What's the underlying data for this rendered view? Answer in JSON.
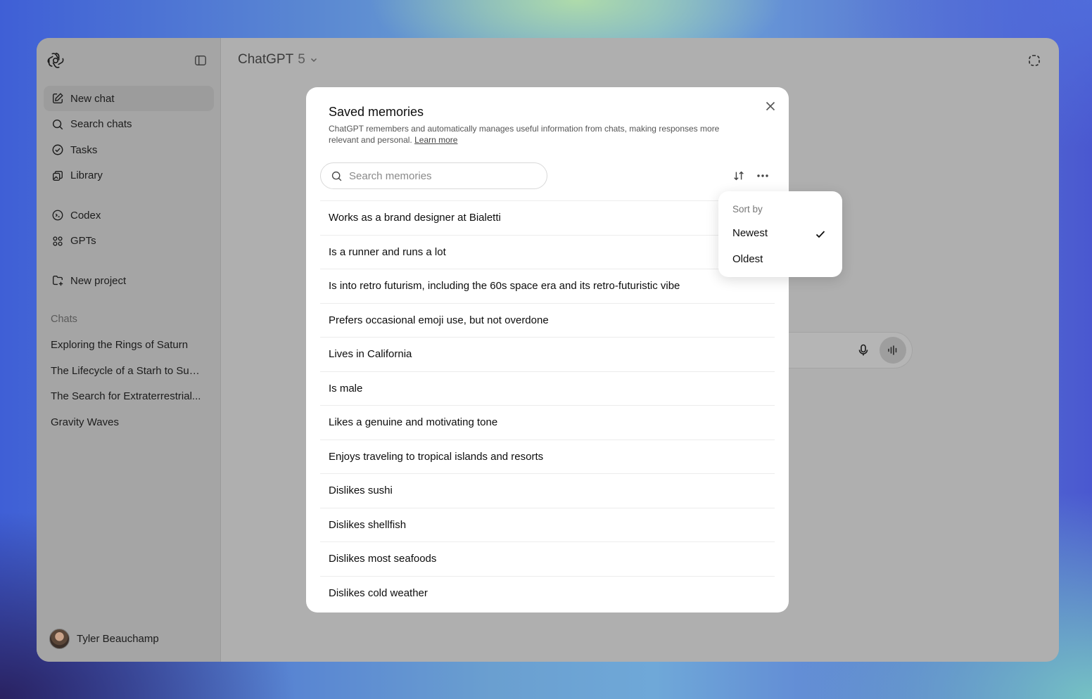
{
  "app": {
    "model_name": "ChatGPT",
    "model_version": "5"
  },
  "sidebar": {
    "nav": [
      {
        "label": "New chat",
        "icon": "edit-icon"
      },
      {
        "label": "Search chats",
        "icon": "search-icon"
      },
      {
        "label": "Tasks",
        "icon": "check-circle-icon"
      },
      {
        "label": "Library",
        "icon": "library-icon"
      },
      {
        "label": "Codex",
        "icon": "terminal-icon"
      },
      {
        "label": "GPTs",
        "icon": "grid-icon"
      },
      {
        "label": "New project",
        "icon": "folder-plus-icon"
      }
    ],
    "chats_heading": "Chats",
    "chats": [
      "Exploring the Rings of Saturn",
      "The Lifecycle of a Starh to Sup...",
      "The Search for Extraterrestrial...",
      "Gravity Waves"
    ],
    "user_name": "Tyler Beauchamp"
  },
  "modal": {
    "title": "Saved memories",
    "description": "ChatGPT remembers and automatically manages useful information from chats, making responses more relevant and personal.",
    "learn_more": "Learn more",
    "search_placeholder": "Search memories",
    "memories": [
      "Works as a brand designer at Bialetti",
      "Is a runner and runs a lot",
      "Is into retro futurism, including the 60s space era and its retro-futuristic vibe",
      "Prefers occasional emoji use, but not overdone",
      "Lives in California",
      "Is male",
      "Likes a genuine and motivating tone",
      "Enjoys traveling to tropical islands and resorts",
      "Dislikes sushi",
      "Dislikes shellfish",
      "Dislikes most seafoods",
      "Dislikes cold weather"
    ]
  },
  "sort_menu": {
    "label": "Sort by",
    "options": [
      "Newest",
      "Oldest"
    ],
    "selected": "Newest"
  }
}
